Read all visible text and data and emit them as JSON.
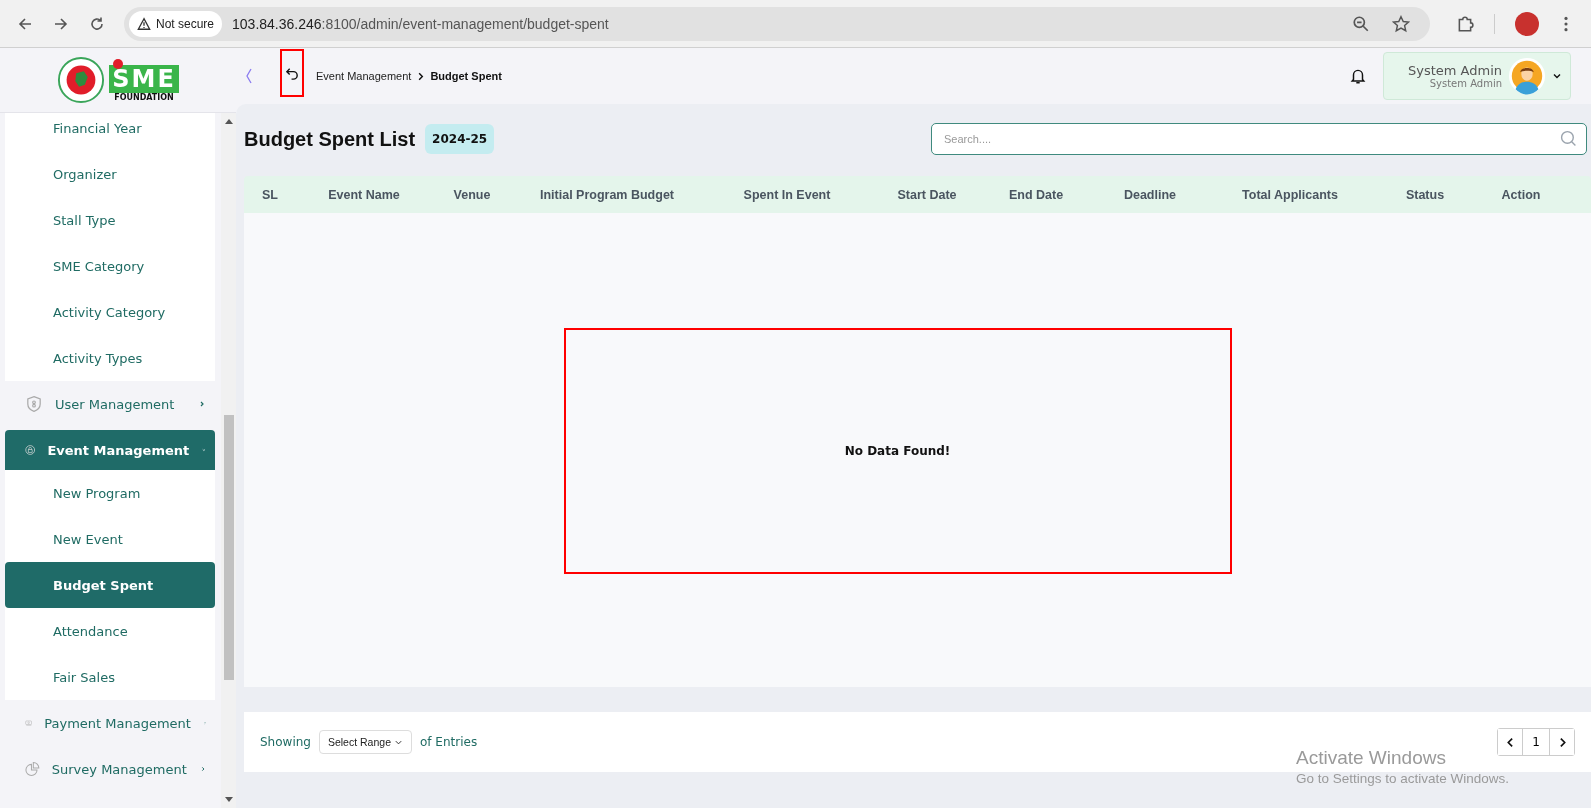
{
  "browser": {
    "security": "Not secure",
    "url_host": "103.84.36.246",
    "url_rest": ":8100/admin/event-management/budget-spent"
  },
  "logo": {
    "text": "SME",
    "subtitle": "FOUNDATION"
  },
  "breadcrumb": [
    {
      "label": "Event Management",
      "current": false
    },
    {
      "label": "Budget Spent",
      "current": true
    }
  ],
  "user": {
    "name": "System Admin",
    "role": "System Admin"
  },
  "sidebar": {
    "submenu": [
      {
        "label": "Financial Year",
        "selected": false
      },
      {
        "label": "Organizer",
        "selected": false
      },
      {
        "label": "Stall Type",
        "selected": false
      },
      {
        "label": "SME Category",
        "selected": false
      },
      {
        "label": "Activity Category",
        "selected": false
      },
      {
        "label": "Activity Types",
        "selected": false
      }
    ],
    "items": [
      {
        "label": "User Management",
        "expanded": false
      },
      {
        "label": "Event Management",
        "expanded": true,
        "children": [
          {
            "label": "New Program",
            "selected": false
          },
          {
            "label": "New Event",
            "selected": false
          },
          {
            "label": "Budget Spent",
            "selected": true
          },
          {
            "label": "Attendance",
            "selected": false
          },
          {
            "label": "Fair Sales",
            "selected": false
          }
        ]
      },
      {
        "label": "Payment Management",
        "expanded": false
      },
      {
        "label": "Survey Management",
        "expanded": false
      }
    ]
  },
  "page": {
    "title": "Budget Spent List",
    "year_badge": "2024-25",
    "search": {
      "placeholder": "Search...."
    }
  },
  "table": {
    "columns": [
      "SL",
      "Event Name",
      "Venue",
      "Initial Program Budget",
      "Spent In Event",
      "Start Date",
      "End Date",
      "Deadline",
      "Total Applicants",
      "Status",
      "Action"
    ],
    "empty_message": "No Data Found!"
  },
  "footer": {
    "showing": "Showing",
    "range_select": "Select Range",
    "entries": "of Entries",
    "page": "1"
  },
  "os_notice": {
    "title": "Activate Windows",
    "subtitle": "Go to Settings to activate Windows."
  }
}
